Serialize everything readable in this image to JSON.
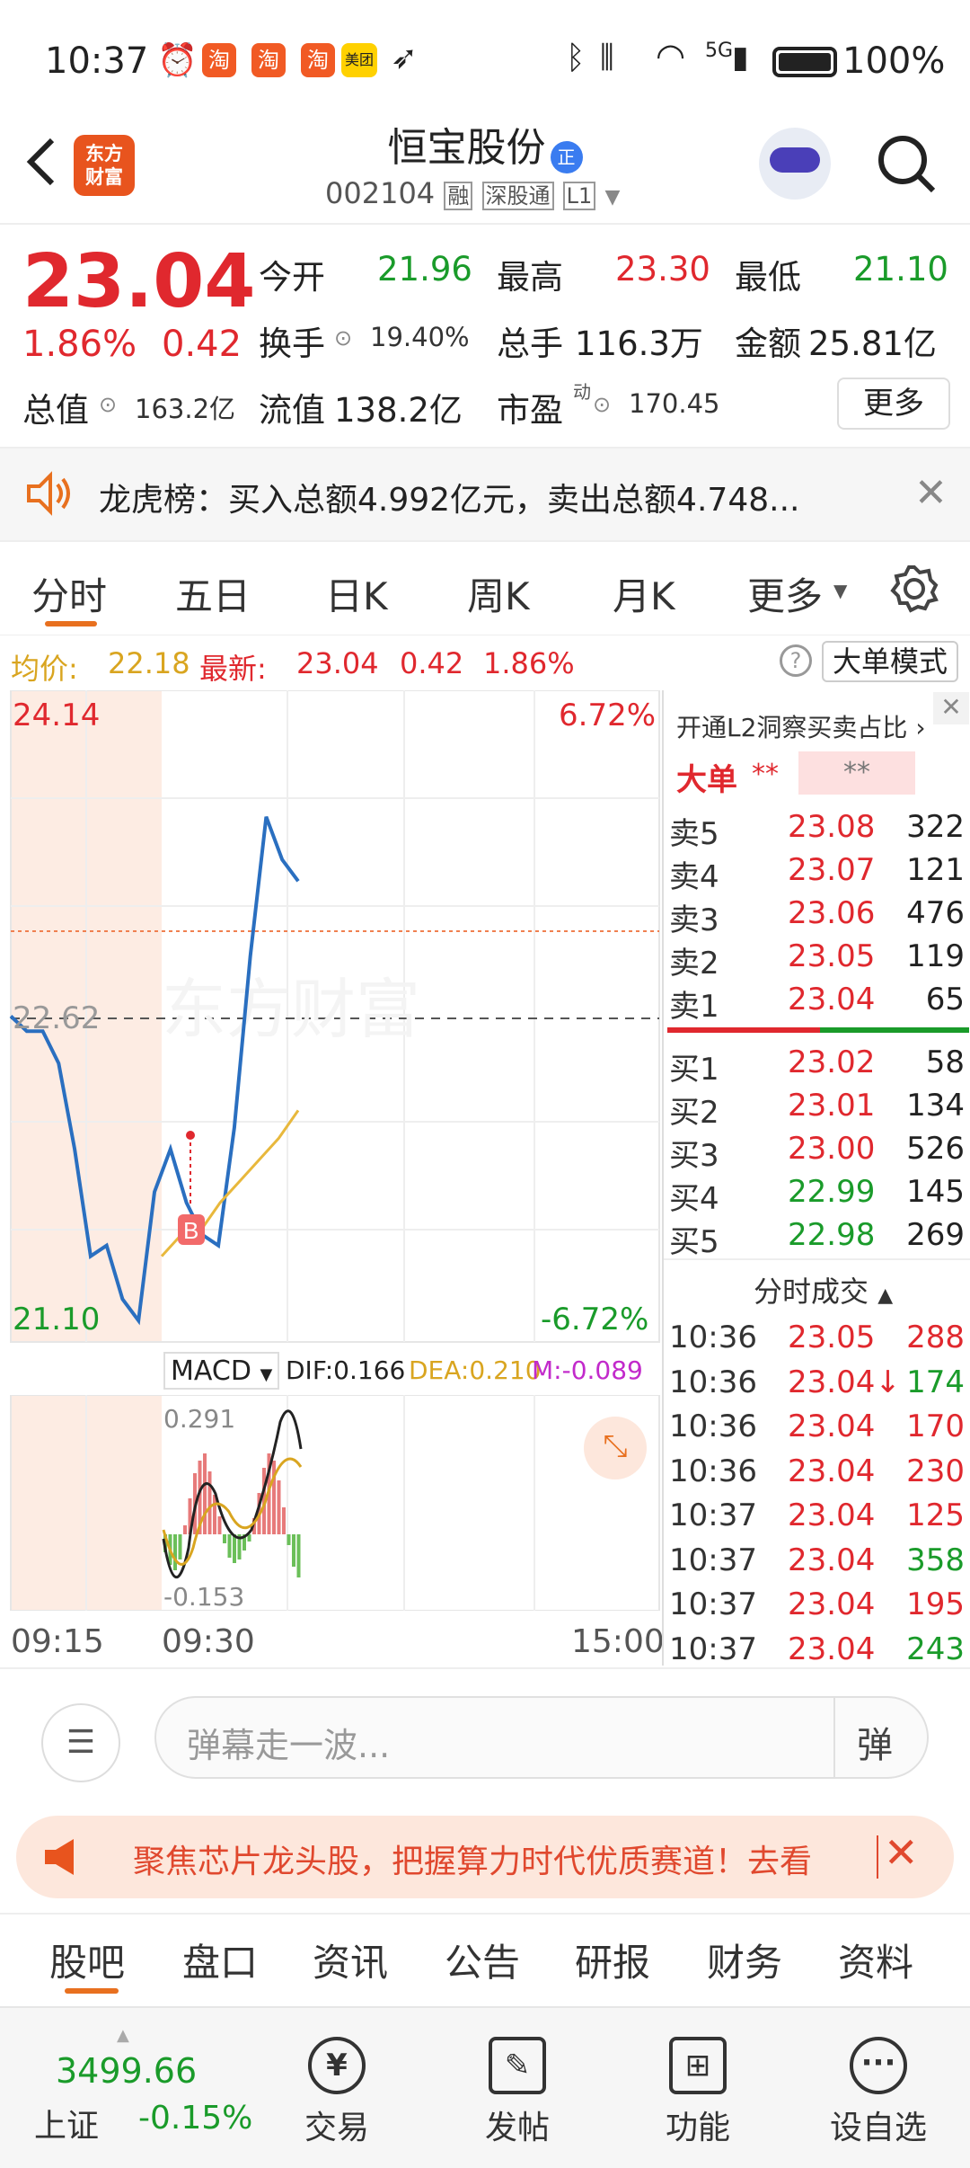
{
  "status_bar": {
    "time": "10:37",
    "battery": "100%",
    "network": "5G",
    "app_badges": [
      "淘",
      "淘",
      "淘",
      "美团"
    ]
  },
  "header": {
    "logo_text": "东方\n财富",
    "stock_name": "恒宝股份",
    "stock_badge": "正",
    "stock_code": "002104",
    "tags": [
      "融",
      "深股通",
      "L1"
    ]
  },
  "quote": {
    "price": "23.04",
    "change_pct": "1.86%",
    "change_amt": "0.42",
    "open_label": "今开",
    "open": "21.96",
    "high_label": "最高",
    "high": "23.30",
    "low_label": "最低",
    "low": "21.10",
    "turnover_label": "换手",
    "turnover": "19.40%",
    "volume_label": "总手",
    "volume": "116.3万",
    "amount_label": "金额",
    "amount": "25.81亿",
    "mktcap_label": "总值",
    "mktcap": "163.2亿",
    "float_label": "流值",
    "float": "138.2亿",
    "pe_label": "市盈",
    "pe_sup": "动",
    "pe": "170.45",
    "more_button": "更多"
  },
  "notice": {
    "text": "龙虎榜：买入总额4.992亿元，卖出总额4.748..."
  },
  "tabs": {
    "items": [
      "分时",
      "五日",
      "日K",
      "周K",
      "月K",
      "更多"
    ],
    "active": "分时"
  },
  "info_bar": {
    "avg_label": "均价:",
    "avg": "22.18",
    "latest_label": "最新:",
    "latest": "23.04",
    "chg": "0.42",
    "pct": "1.86%",
    "mode_button": "大单模式"
  },
  "chart_labels": {
    "top_price": "24.14",
    "mid_price": "22.62",
    "bottom_price": "21.10",
    "top_pct": "6.72%",
    "bottom_pct": "-6.72%",
    "watermark": "东方财富",
    "buy_marker": "B",
    "time_start": "09:15",
    "time_open": "09:30",
    "time_end": "15:00"
  },
  "chart_data": {
    "type": "line",
    "y_range": [
      21.1,
      24.14
    ],
    "series": [
      {
        "values": [
          22.62,
          22.55,
          22.55,
          22.4,
          22.0,
          21.5,
          21.55,
          21.3,
          21.2,
          21.8,
          22.0,
          21.75,
          21.6,
          21.55,
          22.1,
          22.9,
          23.55,
          23.35,
          23.25
        ]
      },
      {
        "values": [
          21.5,
          21.6,
          21.62,
          21.75,
          21.85,
          21.95,
          22.05,
          22.18
        ]
      }
    ]
  },
  "macd": {
    "selector": "MACD",
    "dif": "DIF:0.166",
    "dea": "DEA:0.210",
    "m": "M:-0.089",
    "top": "0.291",
    "bottom": "-0.153"
  },
  "order_book": {
    "l2_text": "开通L2洞察买卖占比",
    "big_label": "大单",
    "masked": [
      "**",
      "**"
    ],
    "sells": [
      {
        "label": "卖5",
        "price": "23.08",
        "vol": "322"
      },
      {
        "label": "卖4",
        "price": "23.07",
        "vol": "121"
      },
      {
        "label": "卖3",
        "price": "23.06",
        "vol": "476"
      },
      {
        "label": "卖2",
        "price": "23.05",
        "vol": "119"
      },
      {
        "label": "卖1",
        "price": "23.04",
        "vol": "65"
      }
    ],
    "buys": [
      {
        "label": "买1",
        "price": "23.02",
        "vol": "58"
      },
      {
        "label": "买2",
        "price": "23.01",
        "vol": "134"
      },
      {
        "label": "买3",
        "price": "23.00",
        "vol": "526"
      },
      {
        "label": "买4",
        "price": "22.99",
        "vol": "145"
      },
      {
        "label": "买5",
        "price": "22.98",
        "vol": "269"
      }
    ],
    "trades_title": "分时成交",
    "trades": [
      {
        "time": "10:36",
        "price": "23.05",
        "vol": "288"
      },
      {
        "time": "10:36",
        "price": "23.04↓",
        "vol": "174"
      },
      {
        "time": "10:36",
        "price": "23.04",
        "vol": "170"
      },
      {
        "time": "10:36",
        "price": "23.04",
        "vol": "230"
      },
      {
        "time": "10:37",
        "price": "23.04",
        "vol": "125"
      },
      {
        "time": "10:37",
        "price": "23.04",
        "vol": "358"
      },
      {
        "time": "10:37",
        "price": "23.04",
        "vol": "195"
      },
      {
        "time": "10:37",
        "price": "23.04",
        "vol": "243"
      }
    ]
  },
  "comment": {
    "placeholder": "弹幕走一波...",
    "danmu_button": "弹"
  },
  "banner": {
    "text": "聚焦芯片龙头股，把握算力时代优质赛道！去看"
  },
  "sub_tabs": {
    "items": [
      "股吧",
      "盘口",
      "资讯",
      "公告",
      "研报",
      "财务",
      "资料"
    ],
    "active": "股吧"
  },
  "bottom_nav": {
    "index_value": "3499.66",
    "index_name": "上证",
    "index_pct": "-0.15%",
    "items": [
      "交易",
      "发帖",
      "功能",
      "设自选"
    ]
  }
}
